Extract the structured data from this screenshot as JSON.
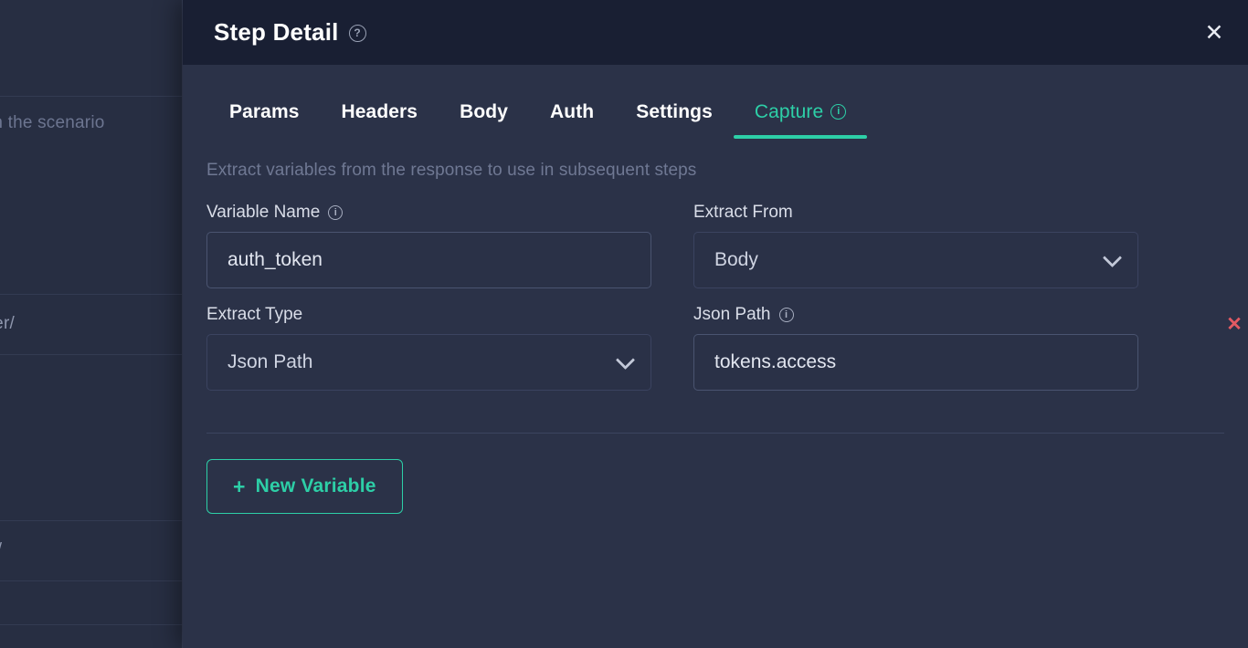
{
  "backdrop": {
    "scenario_text": "ps in the scenario",
    "url_fragment_1": "ster/",
    "url_fragment_2": "n/"
  },
  "header": {
    "title": "Step Detail",
    "help_icon": "help-circle-icon",
    "close_icon": "close-icon",
    "close_label": "✕",
    "background_color": "#191f33"
  },
  "tabs": {
    "items": [
      {
        "label": "Params",
        "active": false
      },
      {
        "label": "Headers",
        "active": false
      },
      {
        "label": "Body",
        "active": false
      },
      {
        "label": "Auth",
        "active": false
      },
      {
        "label": "Settings",
        "active": false
      },
      {
        "label": "Capture",
        "active": true
      }
    ],
    "accent_color": "#2dcfa7"
  },
  "capture": {
    "description": "Extract variables from the response to use in subsequent steps",
    "variable": {
      "variable_name_label": "Variable Name",
      "variable_name_value": "auth_token",
      "variable_name_placeholder": "Variable Name",
      "extract_from_label": "Extract From",
      "extract_from_value": "Body",
      "extract_type_label": "Extract Type",
      "extract_type_value": "Json Path",
      "json_path_label": "Json Path",
      "json_path_value": "tokens.access",
      "json_path_placeholder": "Json Path",
      "delete_label": "✕",
      "delete_color": "#e25a63"
    },
    "new_variable_button": {
      "plus": "+",
      "label": "New Variable"
    }
  },
  "colors": {
    "panel_background": "#2b3248",
    "page_background": "#272e42",
    "accent": "#2dcfa7",
    "input_background": "#2a3147",
    "muted_text": "#6f7893"
  }
}
